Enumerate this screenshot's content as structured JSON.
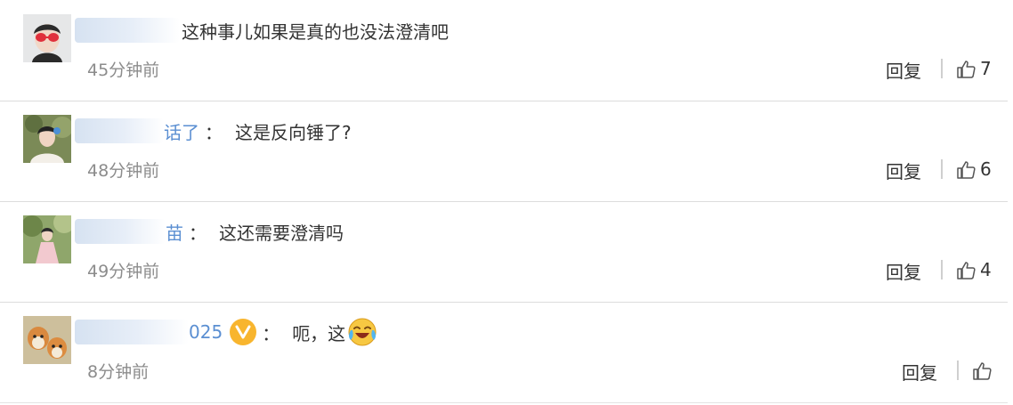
{
  "comments": [
    {
      "username_visible": "",
      "separator": "",
      "text": "这种事儿如果是真的也没法澄清吧",
      "time": "45分钟前",
      "reply_label": "回复",
      "like_count": "7"
    },
    {
      "username_visible": "话了",
      "separator": "：",
      "text": "这是反向锤了?",
      "time": "48分钟前",
      "reply_label": "回复",
      "like_count": "6"
    },
    {
      "username_visible": "苗",
      "separator": "：",
      "text": "这还需要澄清吗",
      "time": "49分钟前",
      "reply_label": "回复",
      "like_count": "4"
    },
    {
      "username_visible": "025",
      "separator": "：",
      "text": "呃，这",
      "time": "8分钟前",
      "reply_label": "回复",
      "like_count": ""
    }
  ],
  "colors": {
    "username": "#5b8fd2",
    "time": "#8c8c8c",
    "divider": "#dcdcdc",
    "verified_badge": "#f8b52e"
  },
  "icons": {
    "like": "thumbs-up-icon",
    "verified": "verified-v-icon",
    "emoji": "laugh-cry-emoji-icon"
  }
}
